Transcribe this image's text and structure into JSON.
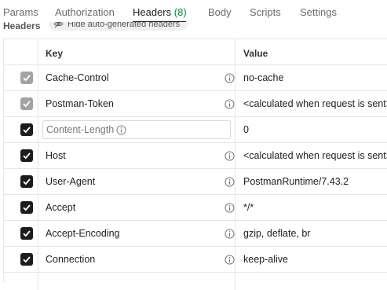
{
  "tabs": [
    {
      "label": "Params"
    },
    {
      "label": "Authorization"
    },
    {
      "label": "Headers",
      "count": "(8)",
      "active": true
    },
    {
      "label": "Body"
    },
    {
      "label": "Scripts"
    },
    {
      "label": "Settings"
    }
  ],
  "subheader": {
    "title": "Headers",
    "hide_label": "Hide auto-generated headers"
  },
  "table": {
    "key_header": "Key",
    "value_header": "Value",
    "rows": [
      {
        "key": "Cache-Control",
        "value": "no-cache",
        "checked": true,
        "disabled": true
      },
      {
        "key": "Postman-Token",
        "value": "<calculated when request is sent>",
        "checked": true,
        "disabled": true
      },
      {
        "key": "Content-Length",
        "value": "0",
        "checked": true,
        "disabled": false,
        "editing": true
      },
      {
        "key": "Host",
        "value": "<calculated when request is sent>",
        "checked": true,
        "disabled": false
      },
      {
        "key": "User-Agent",
        "value": "PostmanRuntime/7.43.2",
        "checked": true,
        "disabled": false
      },
      {
        "key": "Accept",
        "value": "*/*",
        "checked": true,
        "disabled": false
      },
      {
        "key": "Accept-Encoding",
        "value": "gzip, deflate, br",
        "checked": true,
        "disabled": false
      },
      {
        "key": "Connection",
        "value": "keep-alive",
        "checked": true,
        "disabled": false
      }
    ]
  },
  "colors": {
    "accent_count": "#0b8a3d",
    "checkbox_enabled": "#1c1c1c",
    "checkbox_disabled": "#a3a3a3"
  }
}
